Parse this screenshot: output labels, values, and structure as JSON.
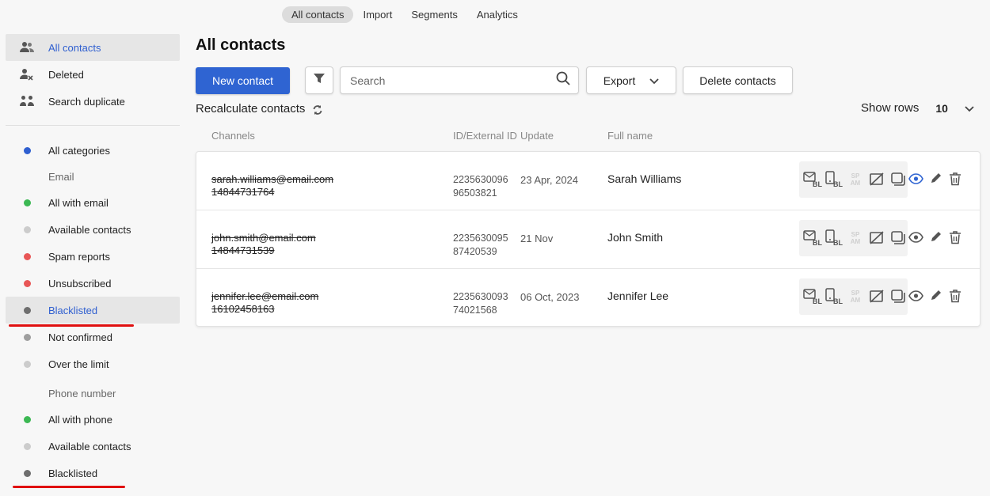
{
  "topnav": {
    "tabs": [
      {
        "label": "All contacts",
        "active": true
      },
      {
        "label": "Import",
        "active": false
      },
      {
        "label": "Segments",
        "active": false
      },
      {
        "label": "Analytics",
        "active": false
      }
    ]
  },
  "sidebar": {
    "main_items": [
      {
        "label": "All contacts",
        "icon": "users-icon"
      },
      {
        "label": "Deleted",
        "icon": "user-deleted-icon"
      },
      {
        "label": "Search duplicate",
        "icon": "duplicate-users-icon"
      }
    ],
    "all_categories": "All categories",
    "email_group": "Email",
    "email_items": [
      {
        "label": "All with email",
        "color": "#3cb853"
      },
      {
        "label": "Available contacts",
        "color": "#cccccc"
      },
      {
        "label": "Spam reports",
        "color": "#e85656"
      },
      {
        "label": "Unsubscribed",
        "color": "#e85656"
      },
      {
        "label": "Blacklisted",
        "color": "#6e6e6e"
      },
      {
        "label": "Not confirmed",
        "color": "#9e9e9e"
      },
      {
        "label": "Over the limit",
        "color": "#cccccc"
      }
    ],
    "phone_group": "Phone number",
    "phone_items": [
      {
        "label": "All with phone",
        "color": "#3cb853"
      },
      {
        "label": "Available contacts",
        "color": "#cccccc"
      },
      {
        "label": "Blacklisted",
        "color": "#6e6e6e"
      }
    ],
    "all_categories_color": "#2f5fd0"
  },
  "main": {
    "title": "All contacts",
    "new_contact": "New contact",
    "search_placeholder": "Search",
    "export": "Export",
    "delete_contacts": "Delete contacts",
    "recalculate": "Recalculate contacts",
    "show_rows_label": "Show rows",
    "show_rows_value": "10"
  },
  "table": {
    "headers": {
      "channels": "Channels",
      "id": "ID/External ID",
      "update": "Update",
      "full_name": "Full name"
    },
    "rows": [
      {
        "email": "sarah.williams@email.com",
        "phone": "14844731764",
        "id1": "2235630096",
        "id2": "96503821",
        "update": "23 Apr, 2024",
        "name": "Sarah Williams"
      },
      {
        "email": "john.smith@email.com",
        "phone": "14844731539",
        "id1": "2235630095",
        "id2": "87420539",
        "update": "21 Nov",
        "name": "John Smith"
      },
      {
        "email": "jennifer.lee@email.com",
        "phone": "16102458163",
        "id1": "2235630093",
        "id2": "74021568",
        "update": "06 Oct, 2023",
        "name": "Jennifer Lee"
      }
    ],
    "spam_label_1": "SP",
    "spam_label_2": "AM",
    "bl_label": "BL"
  },
  "colors": {
    "primary": "#2f64d2",
    "underline": "#e01010"
  }
}
